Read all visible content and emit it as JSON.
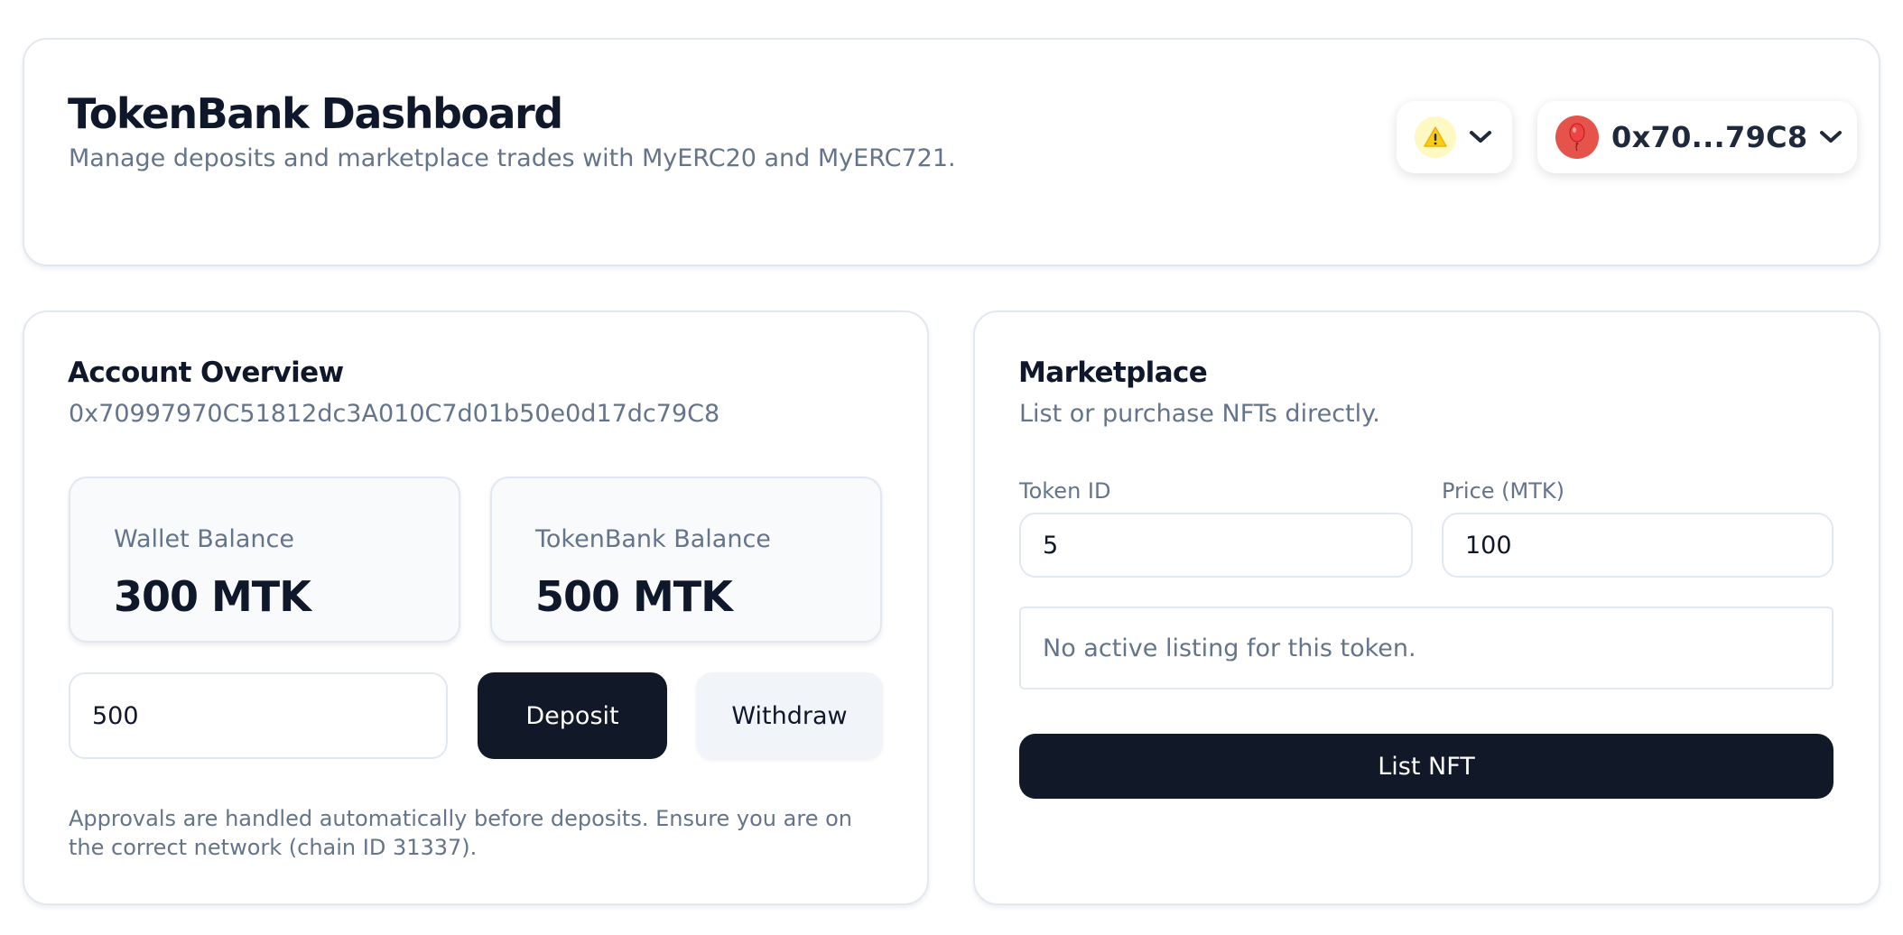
{
  "header": {
    "title": "TokenBank Dashboard",
    "subtitle": "Manage deposits and marketplace trades with MyERC20 and MyERC721.",
    "network_selector": {
      "icon": "network-warning-icon",
      "chevron": "chevron-down-icon"
    },
    "account_selector": {
      "avatar_icon": "balloon-icon",
      "address_short": "0x70...79C8",
      "chevron": "chevron-down-icon"
    }
  },
  "account": {
    "title": "Account Overview",
    "address": "0x70997970C51812dc3A010C7d01b50e0d17dc79C8",
    "wallet_balance_label": "Wallet Balance",
    "wallet_balance_value": "300 MTK",
    "bank_balance_label": "TokenBank Balance",
    "bank_balance_value": "500 MTK",
    "amount_value": "500",
    "deposit_label": "Deposit",
    "withdraw_label": "Withdraw",
    "footnote": "Approvals are handled automatically before deposits. Ensure you are on the correct network (chain ID 31337)."
  },
  "marketplace": {
    "title": "Marketplace",
    "subtitle": "List or purchase NFTs directly.",
    "token_id_label": "Token ID",
    "token_id_value": "5",
    "price_label": "Price (MTK)",
    "price_value": "100",
    "listing_status": "No active listing for this token.",
    "list_button_label": "List NFT"
  },
  "colors": {
    "primary_button": "#111827",
    "secondary_button": "#f1f5f9",
    "muted_text": "#64748b",
    "border": "#e2e8f0",
    "avatar": "#e5534b",
    "network_icon_bg": "#fef9c3",
    "network_icon_fg": "#facc15"
  }
}
